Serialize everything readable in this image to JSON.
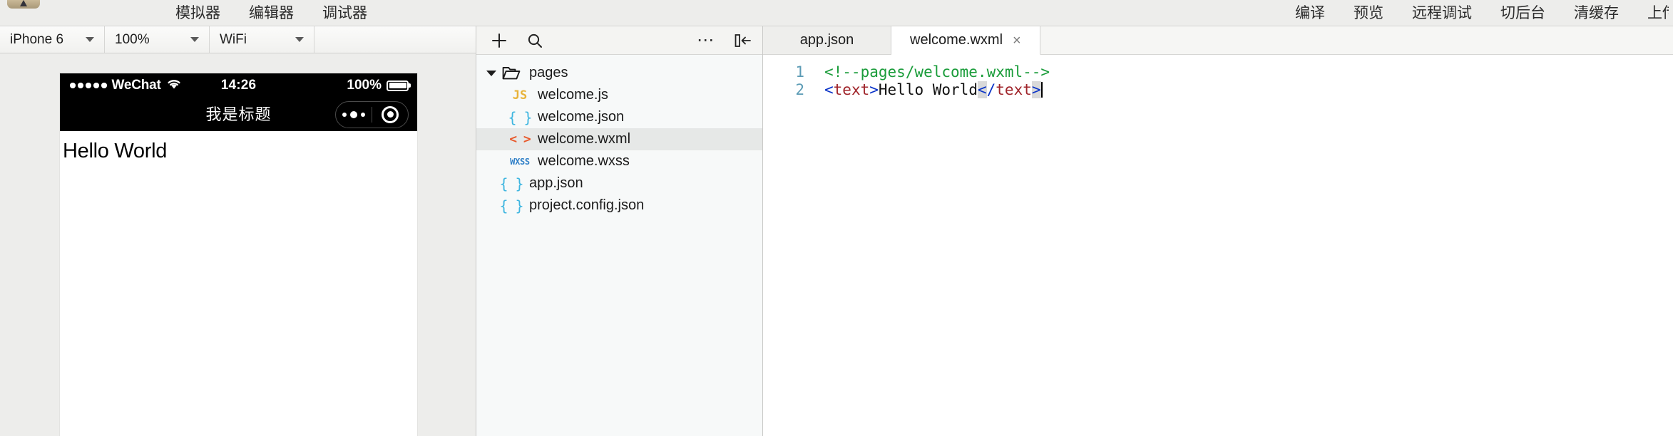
{
  "topbar": {
    "logo_icon": "app-logo-icon",
    "left_menu": [
      {
        "label": "模拟器",
        "name": "simulator"
      },
      {
        "label": "编辑器",
        "name": "editor"
      },
      {
        "label": "调试器",
        "name": "debugger"
      }
    ],
    "right_menu": [
      {
        "label": "编译",
        "name": "compile"
      },
      {
        "label": "预览",
        "name": "preview"
      },
      {
        "label": "远程调试",
        "name": "remote-debug"
      },
      {
        "label": "切后台",
        "name": "switch-background"
      },
      {
        "label": "清缓存",
        "name": "clear-cache"
      },
      {
        "label": "上传",
        "name": "upload"
      }
    ]
  },
  "simulator": {
    "toolbar": {
      "device": "iPhone 6",
      "scale": "100%",
      "network": "WiFi"
    },
    "phone": {
      "status_bar": {
        "signal_dots": 5,
        "carrier": "WeChat",
        "wifi_icon": "wifi-icon",
        "time": "14:26",
        "battery_percent": "100%",
        "battery_icon": "battery-full-icon"
      },
      "nav_title": "我是标题",
      "capsule": {
        "menu_icon": "more-dots-icon",
        "target_icon": "target-circle-icon"
      },
      "page_text": "Hello World"
    }
  },
  "file_tree": {
    "toolbar": {
      "add_icon": "plus-icon",
      "search_icon": "search-icon",
      "more_icon": "more-ellipsis-icon",
      "collapse_icon": "collapse-panel-icon"
    },
    "items": [
      {
        "label": "pages",
        "type": "folder",
        "depth": 1,
        "expanded": true,
        "selected": false,
        "icon": "folder-open-icon"
      },
      {
        "label": "welcome.js",
        "type": "js",
        "depth": 2,
        "expanded": false,
        "selected": false,
        "icon": "js-file-icon",
        "glyph": "JS"
      },
      {
        "label": "welcome.json",
        "type": "json",
        "depth": 2,
        "expanded": false,
        "selected": false,
        "icon": "json-file-icon",
        "glyph": "{ }"
      },
      {
        "label": "welcome.wxml",
        "type": "wxml",
        "depth": 2,
        "expanded": false,
        "selected": true,
        "icon": "wxml-file-icon",
        "glyph": "< >"
      },
      {
        "label": "welcome.wxss",
        "type": "wxss",
        "depth": 2,
        "expanded": false,
        "selected": false,
        "icon": "wxss-file-icon",
        "glyph": "WXSS"
      },
      {
        "label": "app.json",
        "type": "json",
        "depth": 1,
        "expanded": false,
        "selected": false,
        "icon": "json-file-icon",
        "glyph": "{ }"
      },
      {
        "label": "project.config.json",
        "type": "json",
        "depth": 1,
        "expanded": false,
        "selected": false,
        "icon": "json-file-icon",
        "glyph": "{ }"
      }
    ]
  },
  "editor": {
    "tabs": [
      {
        "label": "app.json",
        "active": false,
        "closable": false
      },
      {
        "label": "welcome.wxml",
        "active": true,
        "closable": true,
        "close_icon": "close-icon",
        "close_glyph": "×"
      }
    ],
    "code": {
      "lines": [
        {
          "number": "1",
          "tokens": [
            {
              "text": "<!--pages/welcome.wxml-->",
              "style": "comment"
            }
          ]
        },
        {
          "number": "2",
          "tokens": [
            {
              "text": "<",
              "style": "tag"
            },
            {
              "text": "text",
              "style": "tagname"
            },
            {
              "text": ">",
              "style": "tag"
            },
            {
              "text": "Hello World",
              "style": "plain"
            },
            {
              "text": "<",
              "style": "tag-highlight"
            },
            {
              "text": "/",
              "style": "tag"
            },
            {
              "text": "text",
              "style": "tagname"
            },
            {
              "text": ">",
              "style": "tag-highlight"
            }
          ],
          "cursor": true
        }
      ]
    }
  },
  "colors": {
    "chrome_bg": "#ededeb",
    "tree_bg": "#f7f9f9",
    "tree_selected": "#e6e8e7",
    "editor_bg": "#ffffff",
    "phone_chrome": "#000000",
    "comment_green": "#1a9c3a",
    "tag_blue": "#0a33c8",
    "tagname_red": "#a0252b",
    "gutter_blue": "#5b9bb5",
    "js_yellow": "#e8b339",
    "json_cyan": "#3fb6e0",
    "wxml_orange": "#e8592b",
    "wxss_blue": "#2f7fc7"
  }
}
